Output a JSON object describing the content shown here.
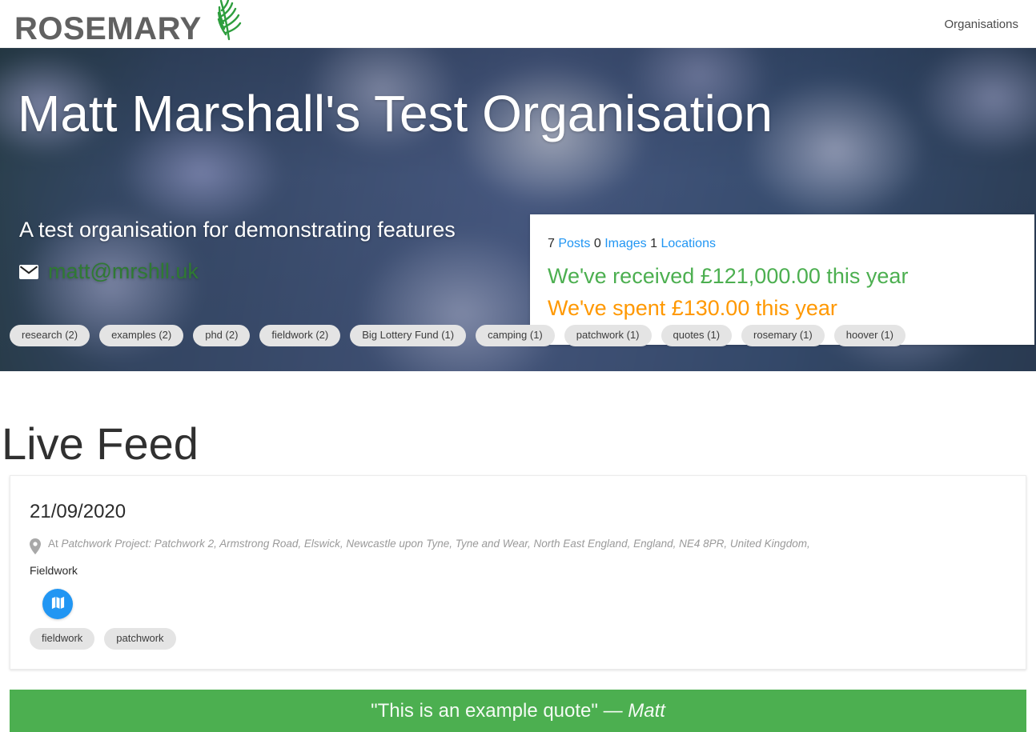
{
  "navbar": {
    "brand_word": "ROSEMARY",
    "brand_sprig_icon": "rosemary-sprig-icon",
    "links": [
      {
        "label": "Organisations"
      }
    ]
  },
  "hero": {
    "title": "Matt Marshall's Test Organisation",
    "subtitle": "A test organisation for demonstrating features",
    "email": "matt@mrshll.uk",
    "mail_icon": "mail-icon",
    "background": "blurred-rosemary-flowers-photo",
    "stats": {
      "posts_count": "7",
      "posts_label": "Posts",
      "images_count": "0",
      "images_label": "Images",
      "locations_count": "1",
      "locations_label": "Locations",
      "received_text": "We've received £121,000.00 this year",
      "spent_text": "We've spent £130.00 this year",
      "received_color": "#4caf50",
      "spent_color": "#ff9800",
      "link_color": "#2196f3"
    },
    "tags": [
      {
        "label": "research (2)"
      },
      {
        "label": "examples (2)"
      },
      {
        "label": "phd (2)"
      },
      {
        "label": "fieldwork (2)"
      },
      {
        "label": "Big Lottery Fund (1)"
      },
      {
        "label": "camping (1)"
      },
      {
        "label": "patchwork (1)"
      },
      {
        "label": "quotes (1)"
      },
      {
        "label": "rosemary (1)"
      },
      {
        "label": "hoover (1)"
      }
    ]
  },
  "feed": {
    "heading": "Live Feed",
    "posts": [
      {
        "date": "21/09/2020",
        "pin_icon": "map-pin-icon",
        "location_prefix": "At ",
        "location": "Patchwork Project: Patchwork 2, Armstrong Road, Elswick, Newcastle upon Tyne, Tyne and Wear, North East England, England, NE4 8PR, United Kingdom,",
        "body": "Fieldwork",
        "map_button_icon": "map-icon",
        "map_button_color": "#2196f3",
        "tags": [
          {
            "label": "fieldwork"
          },
          {
            "label": "patchwork"
          }
        ]
      }
    ]
  },
  "quote_bar": {
    "text": "\"This is an example quote\" — ",
    "author": "Matt",
    "background_color": "#4caf50"
  }
}
